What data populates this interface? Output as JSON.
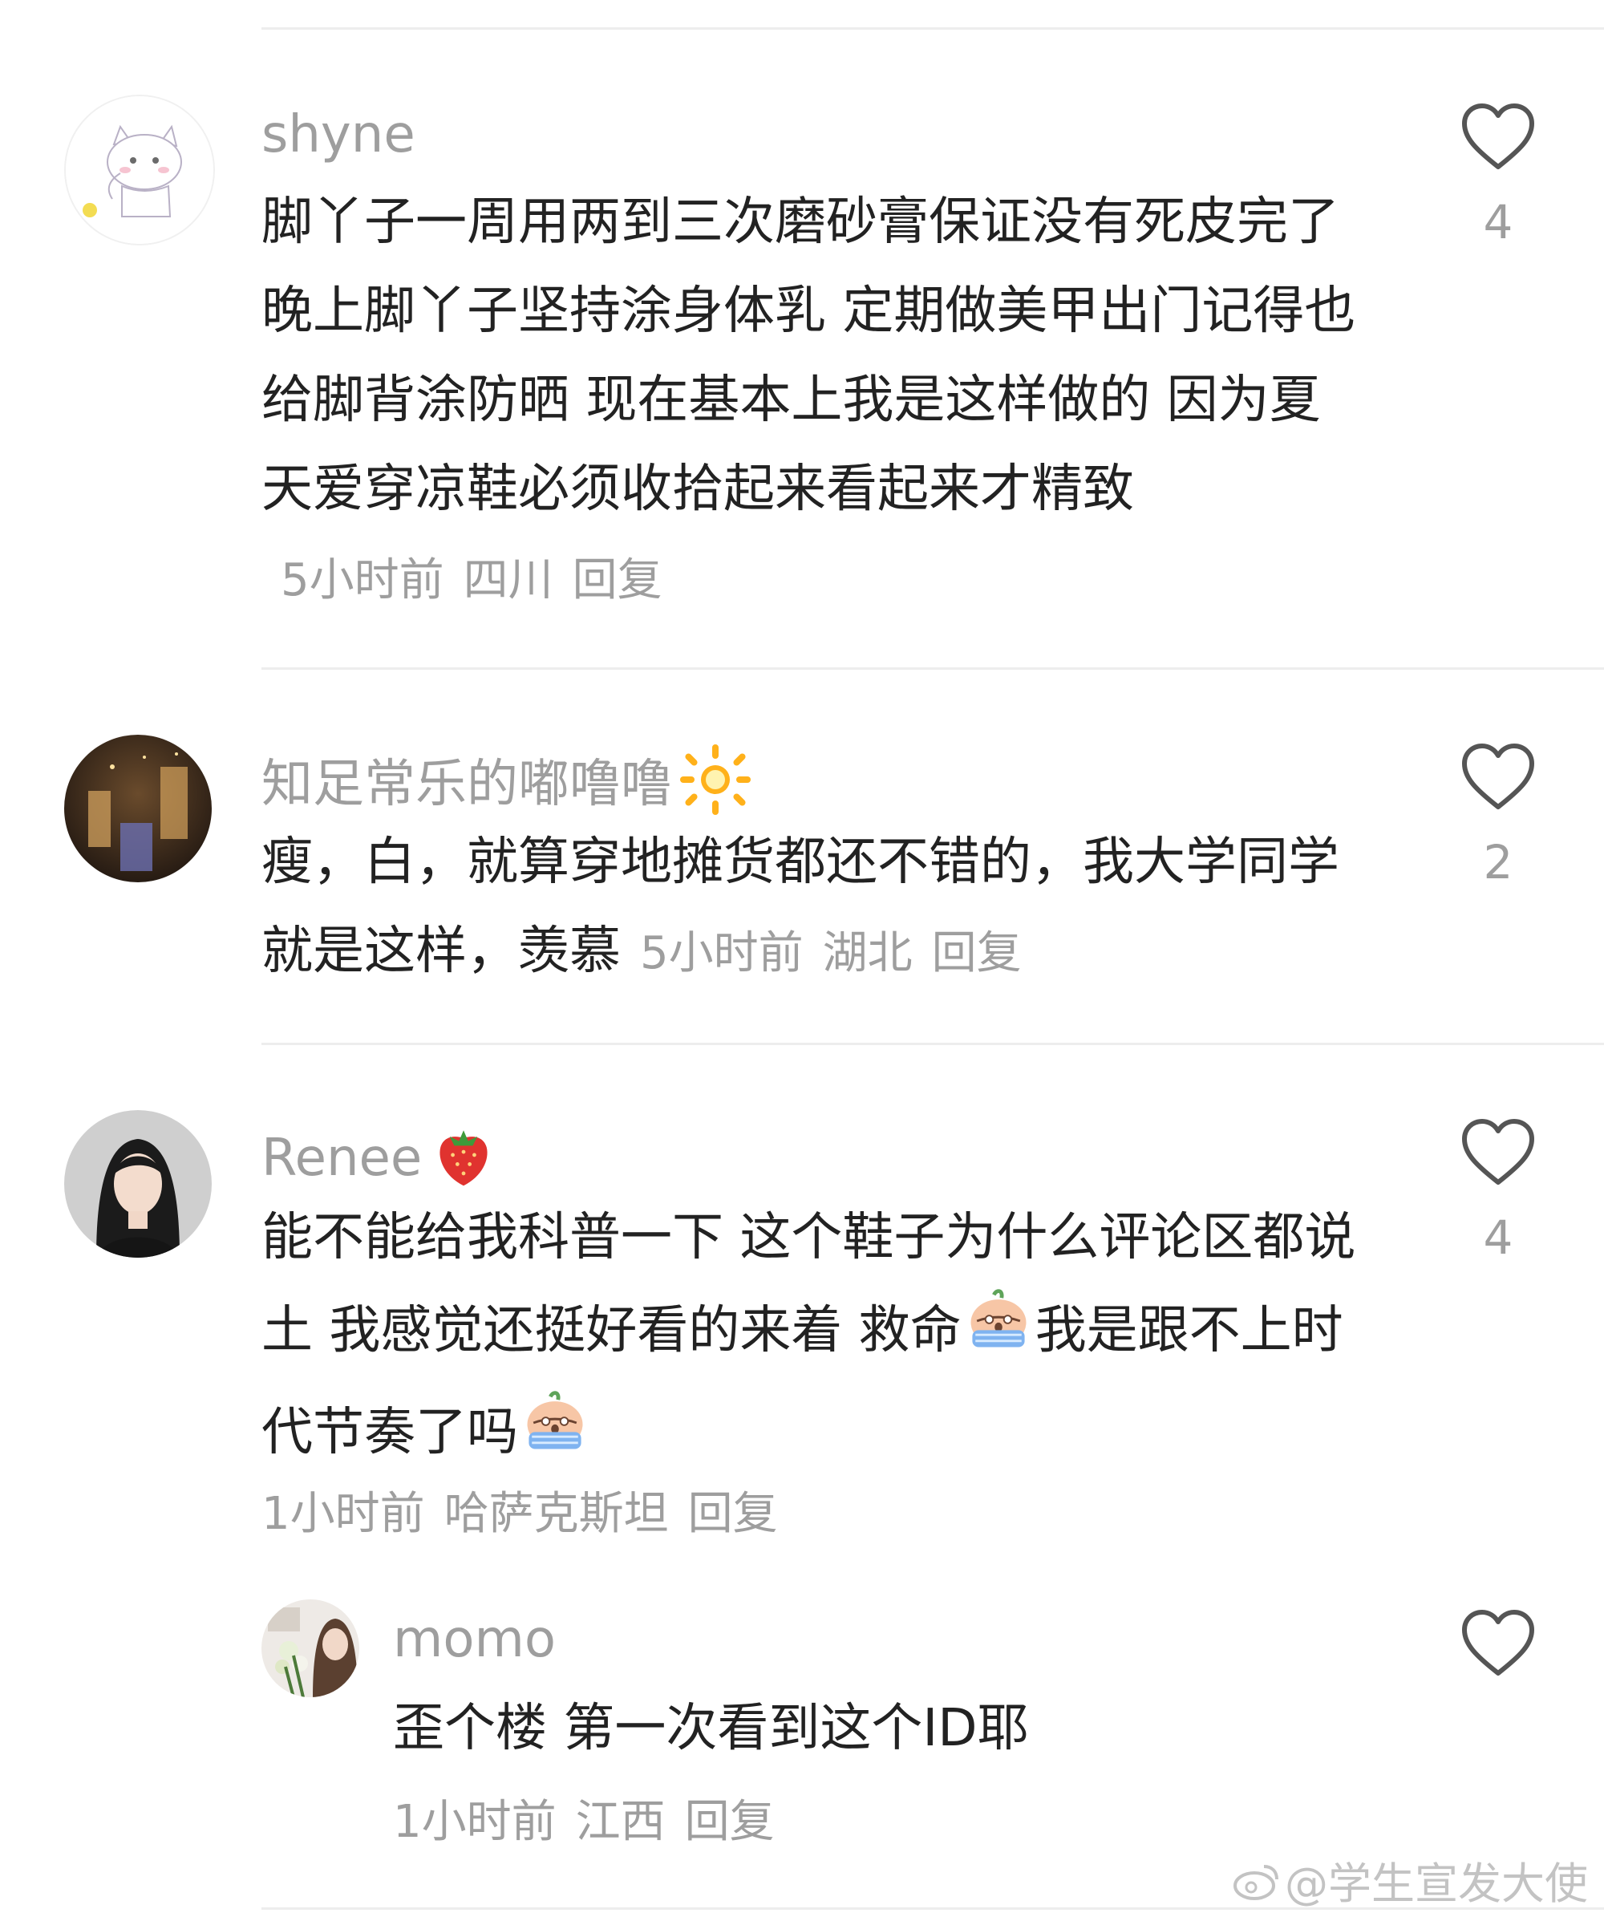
{
  "comments": [
    {
      "username": "shyne",
      "avatar": "white-cat-avatar",
      "text": "脚丫子一周用两到三次磨砂膏保证没有死皮完了晚上脚丫子坚持涂身体乳 定期做美甲出门记得也给脚背涂防晒 现在基本上我是这样做的 因为夏天爱穿凉鞋必须收拾起来看起来才精致",
      "time": "5小时前",
      "location": "四川",
      "reply": "回复",
      "likes": "4"
    },
    {
      "username": "知足常乐的嘟噜噜",
      "username_emoji": "sun-icon",
      "avatar": "night-scene-avatar",
      "text": "瘦，白，就算穿地摊货都还不错的，我大学同学就是这样，羡慕",
      "time": "5小时前",
      "location": "湖北",
      "reply": "回复",
      "likes": "2"
    },
    {
      "username": "Renee",
      "username_emoji": "strawberry-icon",
      "avatar": "portrait-avatar",
      "text_parts": [
        "能不能给我科普一下 这个鞋子为什么评论区都说土 我感觉还挺好看的来着 救命",
        "我是跟不上时代节奏了吗"
      ],
      "text_emoji": "crying-icon",
      "time": "1小时前",
      "location": "哈萨克斯坦",
      "reply": "回复",
      "likes": "4",
      "replies": [
        {
          "username": "momo",
          "avatar": "flowers-portrait-avatar",
          "text": "歪个楼 第一次看到这个ID耶",
          "time": "1小时前",
          "location": "江西",
          "reply": "回复"
        }
      ]
    }
  ],
  "watermark": "@学生宣发大使",
  "colors": {
    "meta": "#9e9e9e",
    "text": "#222222",
    "divider": "#ededed"
  }
}
